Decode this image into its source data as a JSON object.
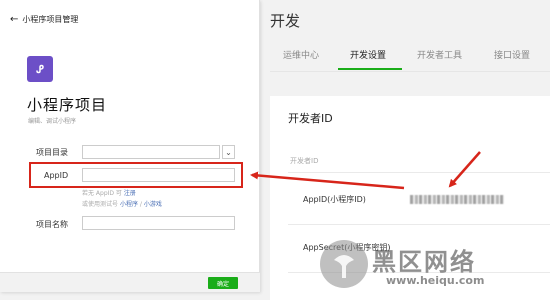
{
  "dialog": {
    "back_icon": "arrow-left-icon",
    "header_title": "小程序项目管理",
    "logo_icon": "mini-program-logo-icon",
    "project_title": "小程序项目",
    "project_subtitle": "编辑、调试小程序",
    "fields": {
      "dir_label": "项目目录",
      "dir_value": "",
      "dir_dropdown_icon": "chevron-down-icon",
      "appid_label": "AppID",
      "appid_value": "",
      "name_label": "项目名称",
      "name_value": ""
    },
    "hint_line1_prefix": "若无 AppID 可",
    "hint_line1_link": "注册",
    "hint_line2_prefix": "或使用测试号",
    "hint_line2_link1": "小程序",
    "hint_line2_sep": "/",
    "hint_line2_link2": "小游戏",
    "ok_button": "确定"
  },
  "panel": {
    "title": "开发",
    "tabs": [
      {
        "label": "运维中心"
      },
      {
        "label": "开发设置"
      },
      {
        "label": "开发者工具"
      },
      {
        "label": "接口设置"
      }
    ],
    "active_tab": "开发设置",
    "card_title": "开发者ID",
    "column_header": "开发者ID",
    "rows": [
      {
        "label": "AppID(小程序ID)"
      },
      {
        "label": "AppSecret(小程序密钥)"
      }
    ]
  },
  "annotations": {
    "highlight_color": "#d7251a",
    "arrow_color": "#d7251a"
  },
  "watermark": {
    "text": "黑区网络",
    "url": "www.heiqu.com"
  }
}
